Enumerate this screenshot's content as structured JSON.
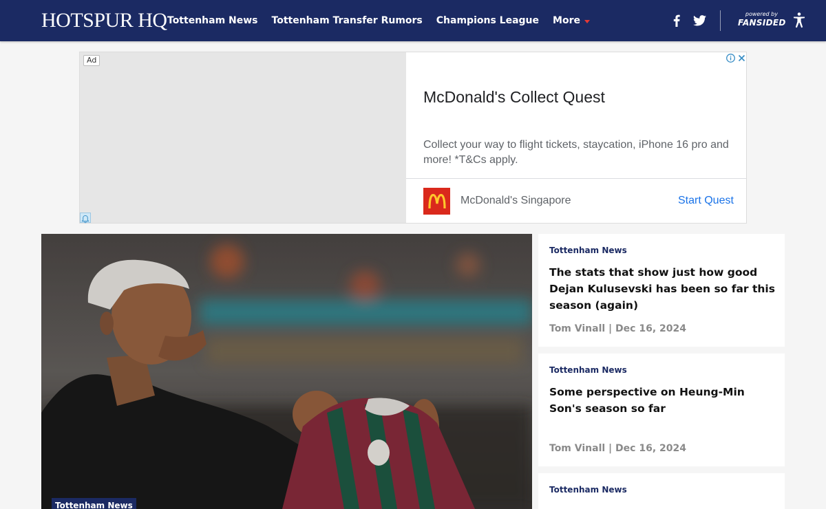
{
  "header": {
    "logo": "HOTSPUR HQ",
    "nav": [
      "Tottenham News",
      "Tottenham Transfer Rumors",
      "Champions League",
      "More"
    ],
    "powered_by": "powered by",
    "powered_brand": "FANSIDED",
    "accent_color": "#1b2a63"
  },
  "ad": {
    "label": "Ad",
    "title": "McDonald's Collect Quest",
    "description": "Collect your way to flight tickets, staycation, iPhone 16 pro and more! *T&Cs apply.",
    "advertiser": "McDonald's Singapore",
    "cta": "Start Quest",
    "icons": [
      "info-icon",
      "close-icon",
      "bell-icon",
      "mcdonalds-logo"
    ]
  },
  "hero": {
    "category": "Tottenham News",
    "image": "player-holding-fluminense-shirt"
  },
  "articles": [
    {
      "category": "Tottenham News",
      "title": "The stats that show just how good Dejan Kulusevski has been so far this season (again)",
      "author": "Tom Vinall",
      "date": "Dec 16, 2024"
    },
    {
      "category": "Tottenham News",
      "title": "Some perspective on Heung-Min Son's season so far",
      "author": "Tom Vinall",
      "date": "Dec 16, 2024"
    },
    {
      "category": "Tottenham News"
    }
  ]
}
